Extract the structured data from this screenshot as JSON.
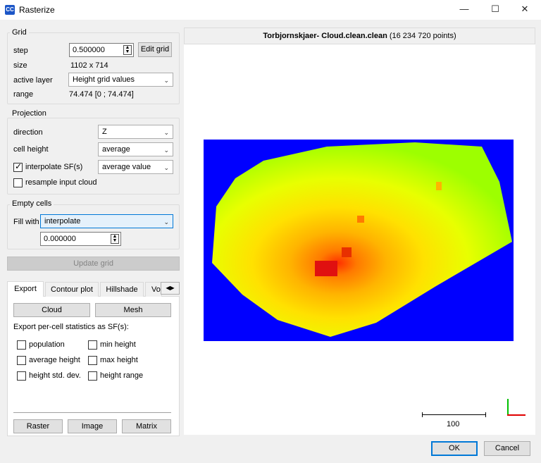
{
  "window": {
    "title": "Rasterize",
    "app_icon": "CC",
    "minimize_glyph": "—",
    "maximize_glyph": "☐",
    "close_glyph": "✕"
  },
  "grid": {
    "title": "Grid",
    "step_label": "step",
    "step_value": "0.500000",
    "edit_grid_label": "Edit grid",
    "size_label": "size",
    "size_value": "1102 x 714",
    "active_layer_label": "active layer",
    "active_layer_value": "Height grid values",
    "range_label": "range",
    "range_value": "74.474 [0 ; 74.474]"
  },
  "projection": {
    "title": "Projection",
    "direction_label": "direction",
    "direction_value": "Z",
    "cell_height_label": "cell height",
    "cell_height_value": "average",
    "interpolate_label": "interpolate SF(s)",
    "interpolate_checked": true,
    "interpolate_value": "average value",
    "resample_label": "resample input cloud",
    "resample_checked": false
  },
  "empty_cells": {
    "title": "Empty cells",
    "fill_with_label": "Fill with",
    "fill_with_value": "interpolate",
    "fill_value": "0.000000"
  },
  "update_grid_label": "Update grid",
  "tabs": {
    "items": [
      "Export",
      "Contour plot",
      "Hillshade",
      "Vo"
    ],
    "active": "Export"
  },
  "export": {
    "cloud_label": "Cloud",
    "mesh_label": "Mesh",
    "stats_label": "Export per-cell statistics as SF(s):",
    "stats": {
      "population": "population",
      "min_height": "min height",
      "average_height": "average height",
      "max_height": "max height",
      "height_std_dev": "height std. dev.",
      "height_range": "height range"
    },
    "raster_label": "Raster",
    "image_label": "Image",
    "matrix_label": "Matrix"
  },
  "viewer": {
    "cloud_name": "Torbjornskjaer- Cloud.clean.clean",
    "point_count": " (16 234 720 points)",
    "scale_label": "100",
    "background_color": "#0000ff"
  },
  "footer": {
    "ok_label": "OK",
    "cancel_label": "Cancel"
  }
}
